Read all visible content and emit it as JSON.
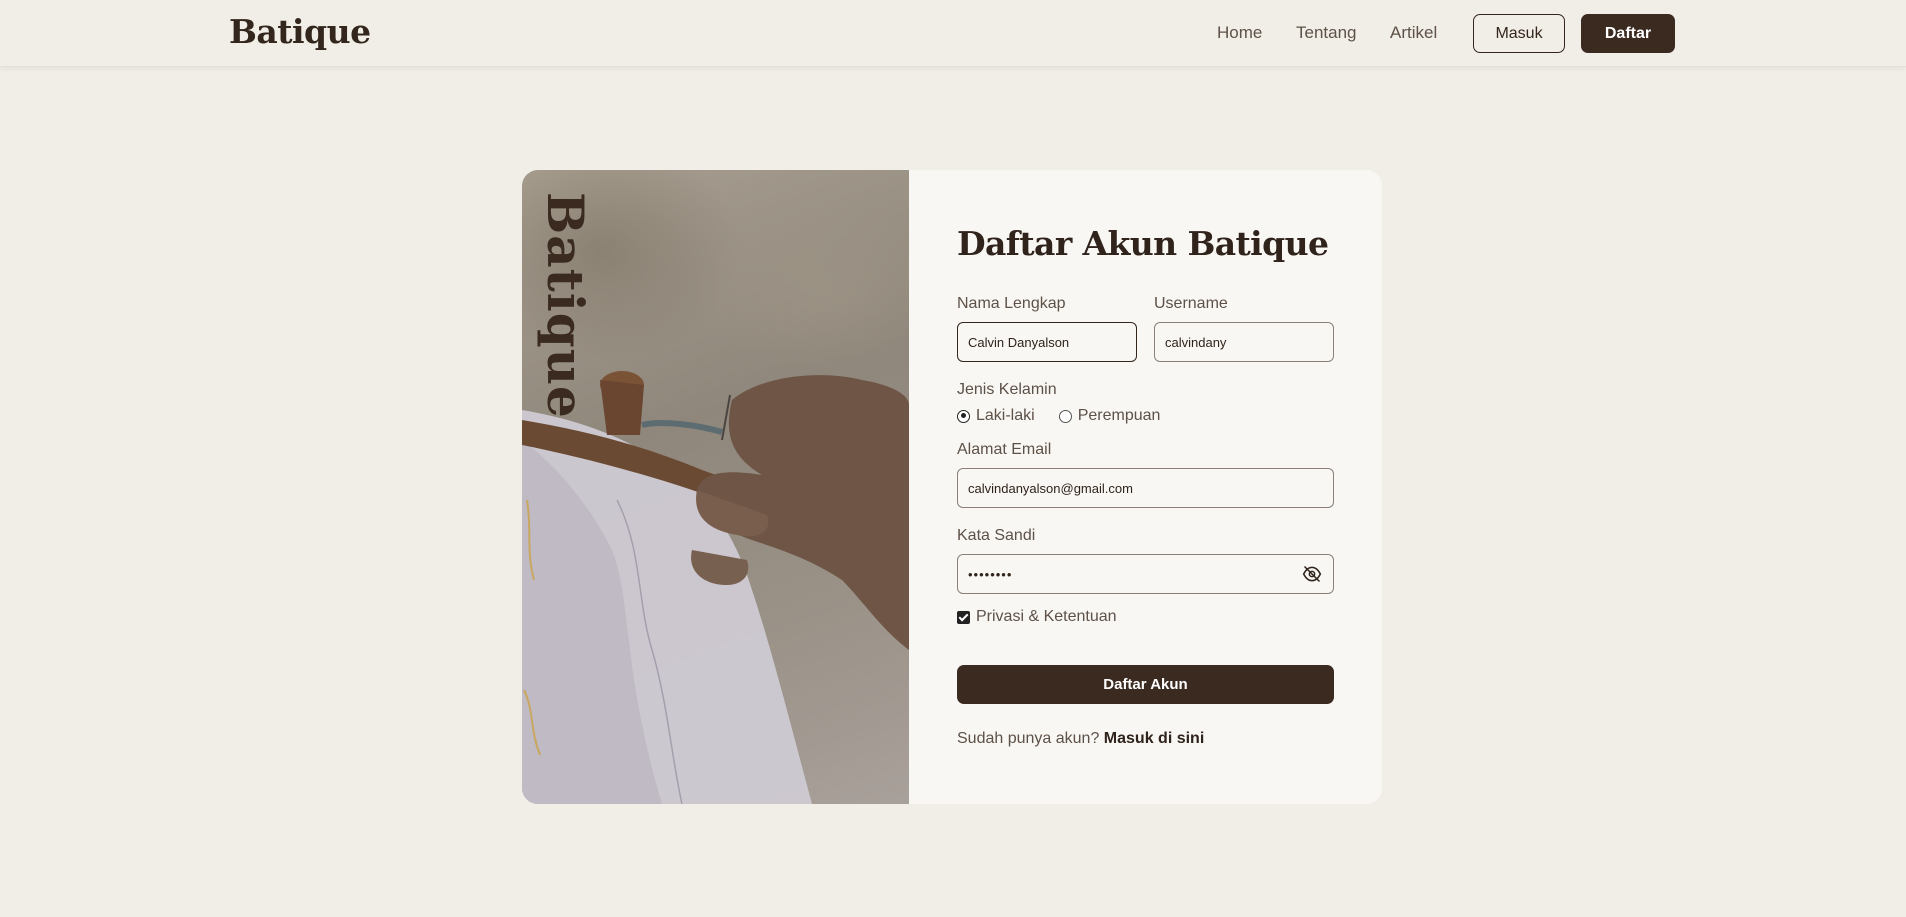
{
  "navbar": {
    "brand": "Batique",
    "links": [
      "Home",
      "Tentang",
      "Artikel"
    ],
    "login_label": "Masuk",
    "register_label": "Daftar"
  },
  "hero": {
    "vertical_brand": "Batique"
  },
  "form": {
    "title": "Daftar Akun Batique",
    "full_name": {
      "label": "Nama Lengkap",
      "value": "Calvin Danyalson"
    },
    "username": {
      "label": "Username",
      "value": "calvindany"
    },
    "gender": {
      "label": "Jenis Kelamin",
      "options": [
        "Laki-laki",
        "Perempuan"
      ],
      "selected": "Laki-laki"
    },
    "email": {
      "label": "Alamat Email",
      "value": "calvindanyalson@gmail.com"
    },
    "password": {
      "label": "Kata Sandi",
      "value": "••••••••"
    },
    "terms": {
      "label": "Privasi & Ketentuan",
      "checked": true
    },
    "submit_label": "Daftar Akun",
    "footer_text": "Sudah punya akun?",
    "footer_link": "Masuk di sini"
  },
  "icons": {
    "password_toggle": "eye-off-icon"
  },
  "colors": {
    "primary": "#3a2a20",
    "background": "#f1eee7",
    "card": "#f9f7f3"
  }
}
